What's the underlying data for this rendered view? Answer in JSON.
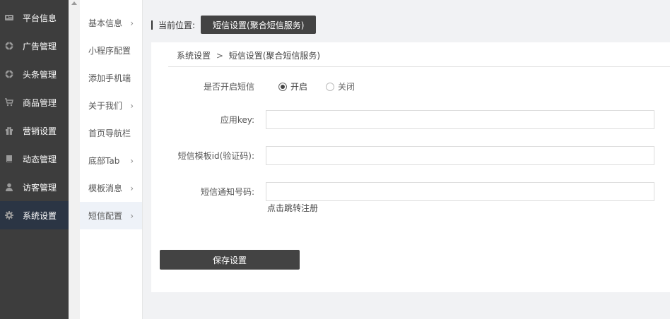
{
  "sidebar": {
    "items": [
      {
        "label": "平台信息",
        "icon": "id-card-icon"
      },
      {
        "label": "广告管理",
        "icon": "globe-icon"
      },
      {
        "label": "头条管理",
        "icon": "globe-icon"
      },
      {
        "label": "商品管理",
        "icon": "cart-icon"
      },
      {
        "label": "营销设置",
        "icon": "gift-icon"
      },
      {
        "label": "动态管理",
        "icon": "book-icon"
      },
      {
        "label": "访客管理",
        "icon": "user-icon"
      },
      {
        "label": "系统设置",
        "icon": "gear-icon"
      }
    ]
  },
  "submenu": {
    "items": [
      {
        "label": "基本信息",
        "arrow": "›"
      },
      {
        "label": "小程序配置",
        "arrow": ""
      },
      {
        "label": "添加手机端",
        "arrow": ""
      },
      {
        "label": "关于我们",
        "arrow": "›"
      },
      {
        "label": "首页导航栏",
        "arrow": ""
      },
      {
        "label": "底部Tab",
        "arrow": "›"
      },
      {
        "label": "模板消息",
        "arrow": "›"
      },
      {
        "label": "短信配置",
        "arrow": "›"
      }
    ]
  },
  "position": {
    "label": "当前位置:",
    "current": "短信设置(聚合短信服务)"
  },
  "breadcrumb": {
    "root": "系统设置",
    "sep": ">",
    "current": "短信设置(聚合短信服务)"
  },
  "form": {
    "enable_label": "是否开启短信",
    "on_label": "开启",
    "off_label": "关闭",
    "selected": "开启",
    "key_label": "应用key:",
    "key_value": "",
    "template_label": "短信模板id(验证码):",
    "template_value": "",
    "notify_label": "短信通知号码:",
    "notify_value": "",
    "hint": "点击跳转注册",
    "save": "保存设置"
  }
}
